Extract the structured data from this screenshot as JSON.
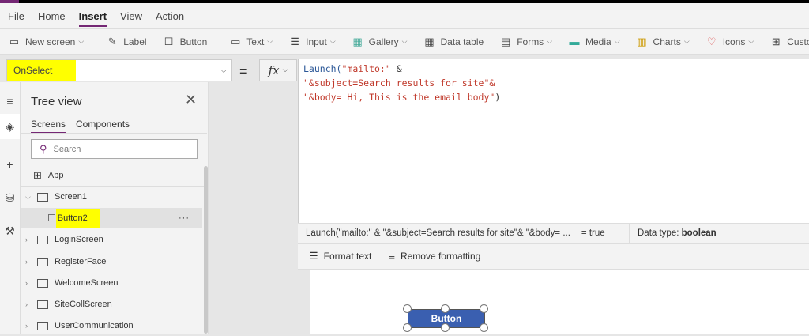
{
  "menu": [
    "File",
    "Home",
    "Insert",
    "View",
    "Action"
  ],
  "ribbon": {
    "new_screen": "New screen",
    "label": "Label",
    "button": "Button",
    "text": "Text",
    "input": "Input",
    "gallery": "Gallery",
    "data_table": "Data table",
    "forms": "Forms",
    "media": "Media",
    "charts": "Charts",
    "icons": "Icons",
    "custom": "Custom"
  },
  "formula": {
    "property": "OnSelect",
    "equals": "=",
    "fx": "fx",
    "line1_fn": "Launch(",
    "line1_str": "\"mailto:\"",
    "line1_rest": " &",
    "line2": "\"&subject=Search results for site\"&",
    "line3_str": "\"&body= Hi, This is the email body\"",
    "line3_rest": ")"
  },
  "result": {
    "expression": "Launch(\"mailto:\" & \"&subject=Search results for site\"& \"&body= ...",
    "value": "=  true",
    "datatype_label": "Data type: ",
    "datatype": "boolean"
  },
  "format": {
    "format_text": "Format text",
    "remove_formatting": "Remove formatting"
  },
  "tree": {
    "title": "Tree view",
    "tabs": [
      "Screens",
      "Components"
    ],
    "search_placeholder": "Search",
    "app": "App",
    "items": [
      "Screen1",
      "Button2",
      "LoginScreen",
      "RegisterFace",
      "WelcomeScreen",
      "SiteCollScreen",
      "UserCommunication"
    ]
  },
  "canvas": {
    "button_label": "Button"
  }
}
